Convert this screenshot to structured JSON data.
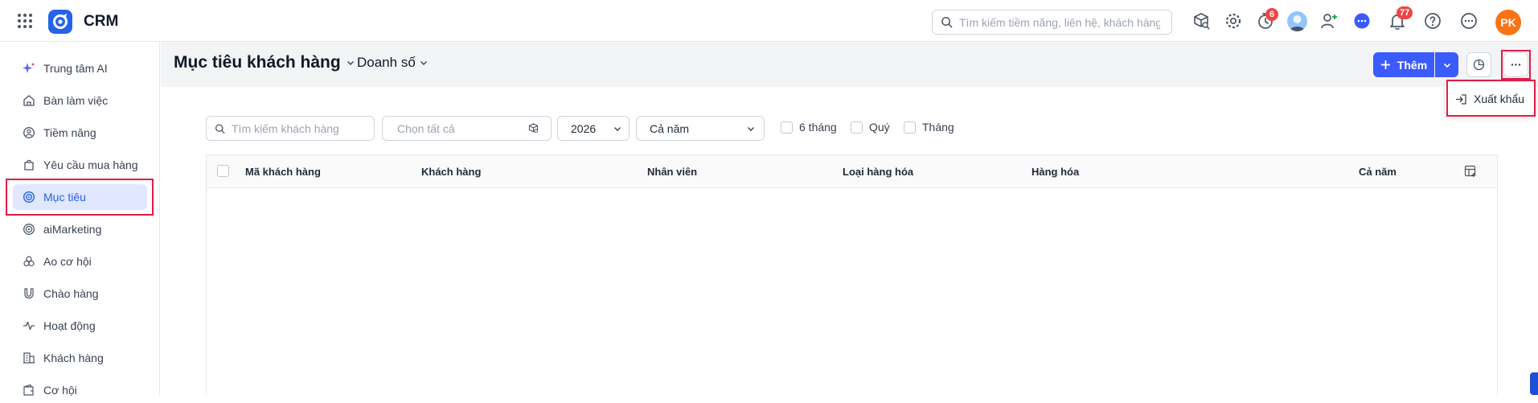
{
  "app": {
    "name": "CRM"
  },
  "search": {
    "placeholder": "Tìm kiếm tiềm năng, liên hệ, khách hàng"
  },
  "topbar": {
    "timer_badge": "6",
    "notification_badge": "77",
    "user_initials": "PK",
    "avatar_color": "#f97316"
  },
  "sidebar": {
    "items": [
      {
        "label": "Trung tâm AI",
        "icon": "sparkle-icon"
      },
      {
        "label": "Bàn làm việc",
        "icon": "home-icon"
      },
      {
        "label": "Tiềm năng",
        "icon": "lead-icon"
      },
      {
        "label": "Yêu cầu mua hàng",
        "icon": "bag-icon"
      },
      {
        "label": "Mục tiêu",
        "icon": "target-icon",
        "active": true
      },
      {
        "label": "aiMarketing",
        "icon": "radar-icon"
      },
      {
        "label": "Ao cơ hội",
        "icon": "pool-icon"
      },
      {
        "label": "Chào hàng",
        "icon": "magnet-icon"
      },
      {
        "label": "Hoạt động",
        "icon": "activity-icon"
      },
      {
        "label": "Khách hàng",
        "icon": "building-icon"
      },
      {
        "label": "Cơ hội",
        "icon": "wallet-icon"
      }
    ]
  },
  "header": {
    "title": "Mục tiêu khách hàng",
    "target_type": "Doanh số",
    "add_label": "Thêm",
    "more_menu": {
      "export_label": "Xuất khẩu"
    }
  },
  "filters": {
    "customer_search_placeholder": "Tìm kiếm khách hàng",
    "select_all_placeholder": "Chọn tất cả",
    "year": "2026",
    "period": "Cả năm",
    "checkboxes": [
      "6 tháng",
      "Quý",
      "Tháng"
    ]
  },
  "table": {
    "columns": [
      "Mã khách hàng",
      "Khách hàng",
      "Nhân viên",
      "Loại hàng hóa",
      "Hàng hóa",
      "Cả năm"
    ],
    "rows": []
  },
  "colors": {
    "primary": "#3b5bfd",
    "active_nav_bg": "#e0e7ff",
    "highlight": "#e11d48"
  }
}
